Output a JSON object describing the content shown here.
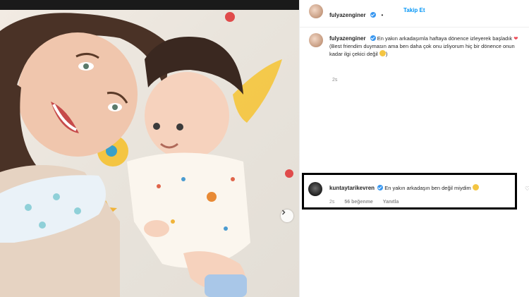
{
  "post": {
    "username": "fulyazenginer",
    "follow_label": "Takip Et",
    "separator": "•",
    "caption_line1": "En yakın arkadaşımla haftaya dönence izleyerek başladık",
    "caption_line2": "(Best friendim duymasın ama ben daha çok onu izliyorum hiç bir dönence onun kadar ilgi çekici değil",
    "caption_end": ")",
    "time": "2s",
    "heart": "❤"
  },
  "comment": {
    "username": "kuntaytarikevren",
    "text": "En yakın arkadaşın ben değil miydim",
    "time": "2s",
    "likes": "56 beğenme",
    "reply": "Yanıtla"
  },
  "icons": {
    "verified": "verified-badge",
    "next": "chevron-right",
    "like": "heart-outline"
  },
  "colors": {
    "link": "#0095f6",
    "verified": "#3897f0",
    "heart": "#ed4956"
  }
}
